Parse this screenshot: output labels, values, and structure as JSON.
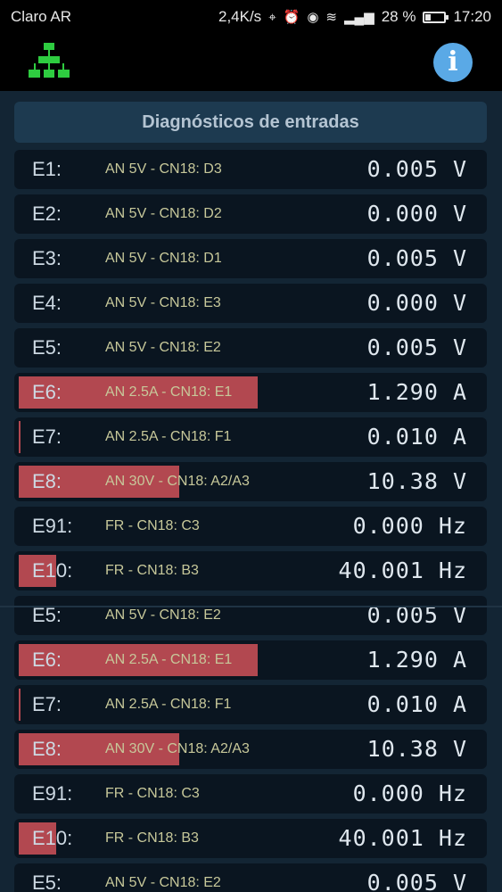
{
  "status_bar": {
    "carrier": "Claro AR",
    "speed": "2,4K/s",
    "battery": "28 %",
    "time": "17:20"
  },
  "app_bar": {
    "left_icon": "network-tree-icon",
    "right_icon": "info-icon",
    "info_glyph": "i"
  },
  "title": "Diagnósticos de entradas",
  "rows": [
    {
      "label": "E1:",
      "source": "AN 5V - CN18: D3",
      "value": "0.005 V",
      "level": 0
    },
    {
      "label": "E2:",
      "source": "AN 5V - CN18: D2",
      "value": "0.000 V",
      "level": 0
    },
    {
      "label": "E3:",
      "source": "AN 5V - CN18: D1",
      "value": "0.005 V",
      "level": 0
    },
    {
      "label": "E4:",
      "source": "AN 5V - CN18: E3",
      "value": "0.000 V",
      "level": 0
    },
    {
      "label": "E5:",
      "source": "AN 5V - CN18: E2",
      "value": "0.005 V",
      "level": 0
    },
    {
      "label": "E6:",
      "source": "AN 2.5A - CN18: E1",
      "value": "1.290 A",
      "level": 0.516
    },
    {
      "label": "E7:",
      "source": "AN 2.5A - CN18: F1",
      "value": "0.010 A",
      "level": 0.004
    },
    {
      "label": "E8:",
      "source": "AN 30V - CN18: A2/A3",
      "value": "10.38 V",
      "level": 0.346
    },
    {
      "label": "E91:",
      "source": "FR - CN18: C3",
      "value": "0.000 Hz",
      "level": 0
    },
    {
      "label": "E10:",
      "source": "FR - CN18: B3",
      "value": "40.001 Hz",
      "level": 0.08
    },
    {
      "label": "E5:",
      "source": "AN 5V - CN18: E2",
      "value": "0.005 V",
      "level": 0
    },
    {
      "label": "E6:",
      "source": "AN 2.5A - CN18: E1",
      "value": "1.290 A",
      "level": 0.516
    },
    {
      "label": "E7:",
      "source": "AN 2.5A - CN18: F1",
      "value": "0.010 A",
      "level": 0.004
    },
    {
      "label": "E8:",
      "source": "AN 30V - CN18: A2/A3",
      "value": "10.38 V",
      "level": 0.346
    },
    {
      "label": "E91:",
      "source": "FR - CN18: C3",
      "value": "0.000 Hz",
      "level": 0
    },
    {
      "label": "E10:",
      "source": "FR - CN18: B3",
      "value": "40.001 Hz",
      "level": 0.08
    },
    {
      "label": "E5:",
      "source": "AN 5V - CN18: E2",
      "value": "0.005 V",
      "level": 0
    }
  ],
  "colors": {
    "bar": "#b24850",
    "header_bg": "#1d3a50",
    "row_bg": "#0a1520",
    "tree_icon": "#2ecc40",
    "info_button": "#5aa9e6"
  }
}
